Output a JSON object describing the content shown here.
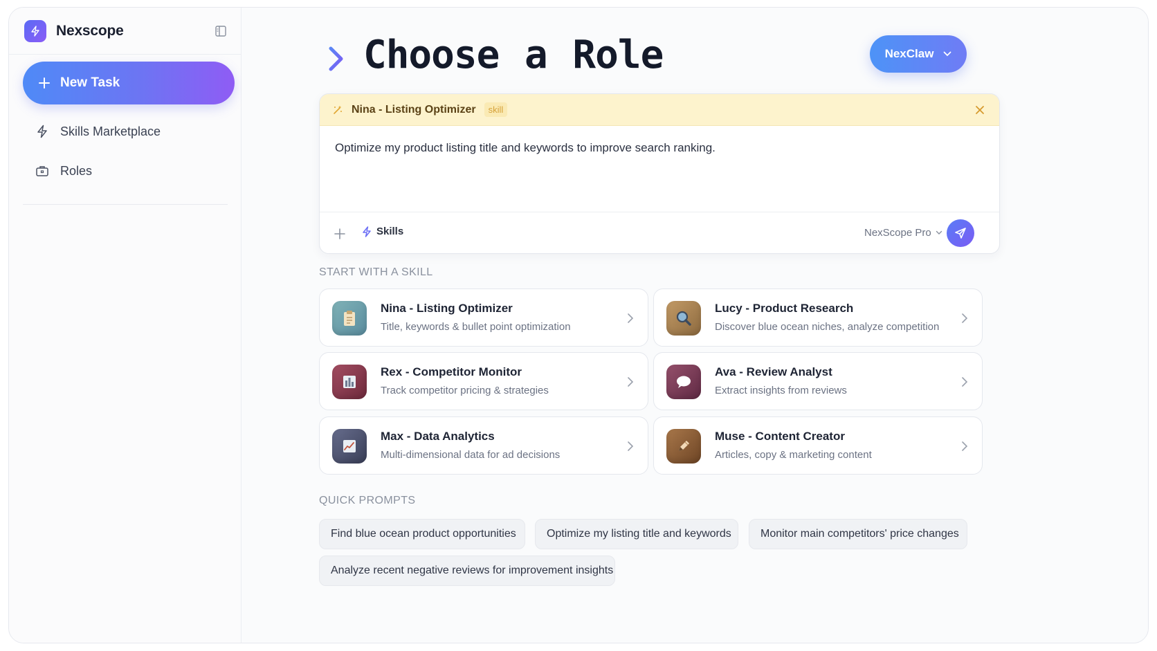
{
  "app": {
    "name": "Nexscope"
  },
  "sidebar": {
    "new_task_label": "New Task",
    "items": [
      {
        "label": "Skills Marketplace",
        "icon": "lightning-icon"
      },
      {
        "label": "Roles",
        "icon": "briefcase-icon"
      }
    ]
  },
  "header": {
    "title": "Choose a Role",
    "model_pill": "NexClaw"
  },
  "composer": {
    "skill_name": "Nina - Listing Optimizer",
    "skill_tag": "skill",
    "prompt": "Optimize my product listing title and keywords to improve search ranking.",
    "skills_label": "Skills",
    "model_label": "NexScope Pro"
  },
  "skills_section": {
    "label": "START WITH A SKILL",
    "cards": [
      {
        "title": "Nina - Listing Optimizer",
        "subtitle": "Title, keywords & bullet point optimization",
        "icon": "clipboard-icon",
        "color": "#6fa0a8"
      },
      {
        "title": "Lucy - Product Research",
        "subtitle": "Discover blue ocean niches, analyze competition",
        "icon": "magnifier-icon",
        "color": "#a8814f"
      },
      {
        "title": "Rex - Competitor Monitor",
        "subtitle": "Track competitor pricing & strategies",
        "icon": "bar-chart-icon",
        "color": "#8e3e50"
      },
      {
        "title": "Ava - Review Analyst",
        "subtitle": "Extract insights from reviews",
        "icon": "speech-bubble-icon",
        "color": "#7d3d55"
      },
      {
        "title": "Max - Data Analytics",
        "subtitle": "Multi-dimensional data for ad decisions",
        "icon": "line-chart-icon",
        "color": "#4f5573"
      },
      {
        "title": "Muse - Content Creator",
        "subtitle": "Articles, copy & marketing content",
        "icon": "pencil-icon",
        "color": "#8a5a32"
      }
    ]
  },
  "quick_prompts": {
    "label": "QUICK PROMPTS",
    "items": [
      "Find blue ocean product opportunities",
      "Optimize my listing title and keywords",
      "Monitor main competitors' price changes",
      "Analyze recent negative reviews for improvement insights"
    ]
  }
}
